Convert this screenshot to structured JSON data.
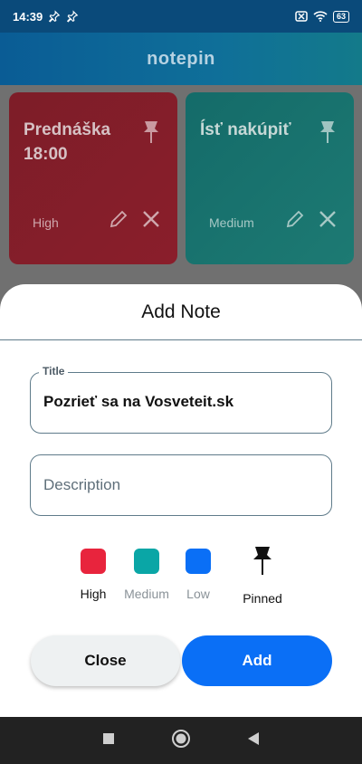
{
  "status_bar": {
    "time": "14:39",
    "battery": "63"
  },
  "app": {
    "title": "notepin"
  },
  "notes": [
    {
      "title": "Prednáška 18:00",
      "priority": "High",
      "color": "#8a1e2b"
    },
    {
      "title": "Ísť nakúpiť",
      "priority": "Medium",
      "color": "#1d7a73"
    }
  ],
  "sheet": {
    "title": "Add Note",
    "title_field": {
      "label": "Title",
      "value": "Pozrieť sa na Vosveteit.sk"
    },
    "description_field": {
      "placeholder": "Description"
    },
    "priorities": [
      {
        "label": "High",
        "color": "#e8243d"
      },
      {
        "label": "Medium",
        "color": "#0aa6a6"
      },
      {
        "label": "Low",
        "color": "#0a6ff6"
      }
    ],
    "pinned_label": "Pinned",
    "close_label": "Close",
    "add_label": "Add"
  }
}
